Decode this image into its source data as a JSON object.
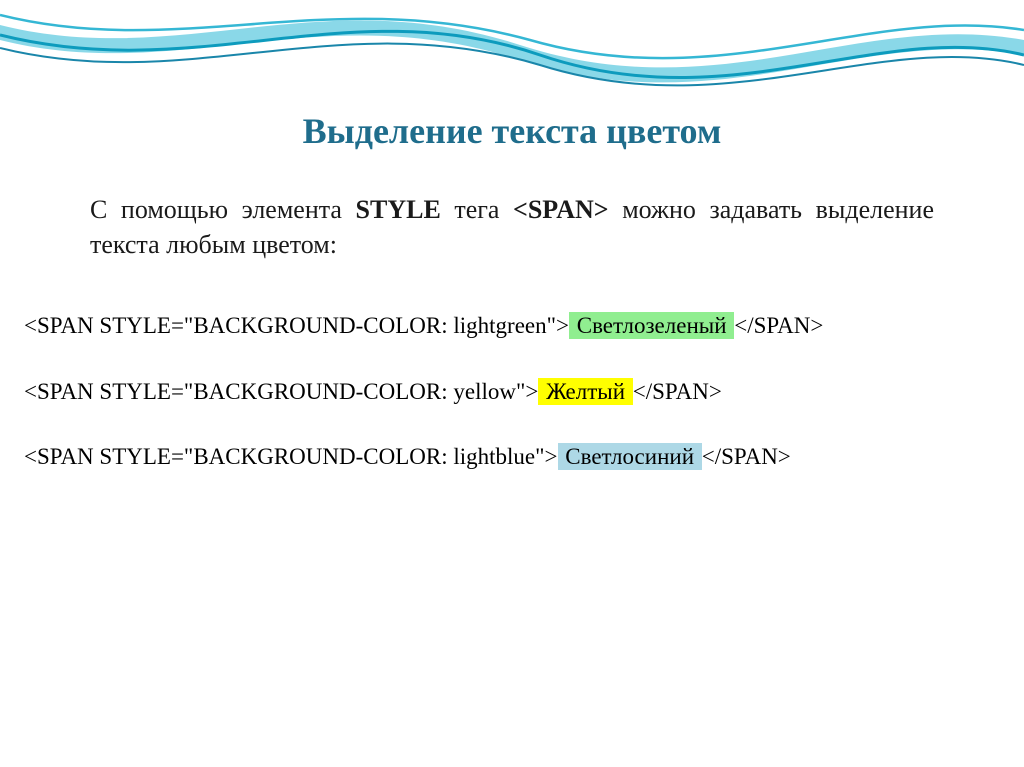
{
  "title": "Выделение текста цветом",
  "intro": {
    "prefix": "С помощью элемента ",
    "style_word": "STYLE",
    "mid": " тега ",
    "span_tag": "<SPAN>",
    "suffix": " можно задавать выделение текста любым цветом:"
  },
  "examples": [
    {
      "open": "<SPAN STYLE=\"BACKGROUND-COLOR: lightgreen\">",
      "text": " Светлозеленый ",
      "close": "</SPAN>",
      "hl_class": "hl-green"
    },
    {
      "open": "<SPAN STYLE=\"BACKGROUND-COLOR: yellow\">",
      "text": " Желтый ",
      "close": "</SPAN>",
      "hl_class": "hl-yellow"
    },
    {
      "open": "<SPAN STYLE=\"BACKGROUND-COLOR: lightblue\">",
      "text": " Светлосиний ",
      "close": "</SPAN>",
      "hl_class": "hl-blue"
    }
  ]
}
